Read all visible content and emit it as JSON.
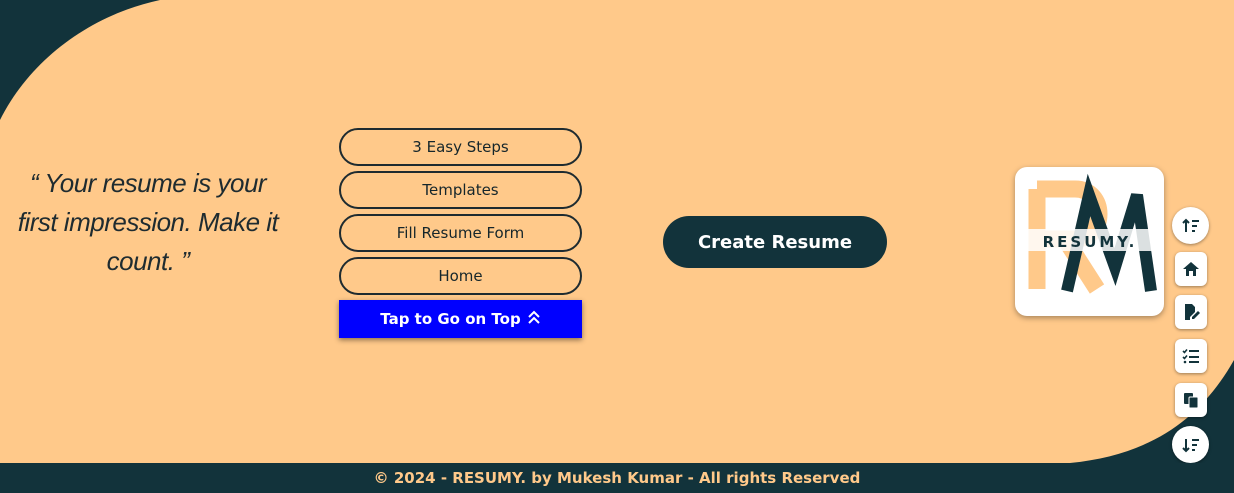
{
  "quote": {
    "text": "“ Your resume is your first impression. Make it count. ”"
  },
  "nav": {
    "items": [
      {
        "label": "3 Easy Steps"
      },
      {
        "label": "Templates"
      },
      {
        "label": "Fill Resume Form"
      },
      {
        "label": "Home"
      }
    ],
    "top_button": "Tap to Go on Top"
  },
  "cta": {
    "label": "Create Resume"
  },
  "logo": {
    "text": "RESUMY."
  },
  "side_icons": [
    "sort-up-icon",
    "home-icon",
    "edit-document-icon",
    "checklist-icon",
    "copy-icon",
    "sort-down-icon"
  ],
  "footer": {
    "text": "© 2024 - RESUMY. by Mukesh Kumar - All rights Reserved"
  },
  "colors": {
    "background": "#ffc98a",
    "dark": "#12333b",
    "button_blue": "#0000ff",
    "footer_text": "#ffc98a"
  }
}
